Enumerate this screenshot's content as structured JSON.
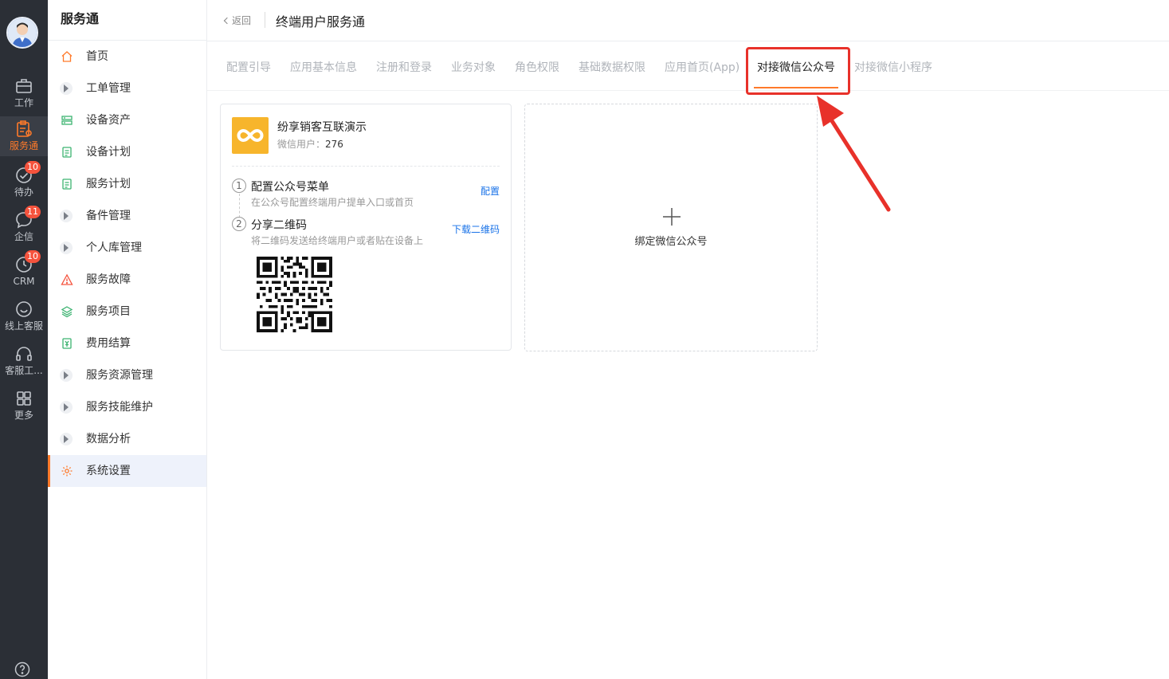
{
  "rail": {
    "items": [
      {
        "label": "工作",
        "icon": "briefcase-icon"
      },
      {
        "label": "服务通",
        "icon": "service-clipboard-icon"
      },
      {
        "label": "待办",
        "icon": "check-circle-icon",
        "badge": "10"
      },
      {
        "label": "企信",
        "icon": "chat-bubble-icon",
        "badge": "11"
      },
      {
        "label": "CRM",
        "icon": "clock-icon",
        "badge": "10"
      },
      {
        "label": "线上客服",
        "icon": "smile-chat-icon"
      },
      {
        "label": "客服工...",
        "icon": "headset-icon"
      },
      {
        "label": "更多",
        "icon": "grid-icon"
      }
    ],
    "active_index": 1,
    "help_icon": "question-circle-icon"
  },
  "sidebar": {
    "title": "服务通",
    "items": [
      {
        "label": "首页",
        "icon": "home-icon"
      },
      {
        "label": "工单管理",
        "icon": "caret-right-icon"
      },
      {
        "label": "设备资产",
        "icon": "device-asset-icon"
      },
      {
        "label": "设备计划",
        "icon": "plan-doc-icon"
      },
      {
        "label": "服务计划",
        "icon": "plan-doc-icon"
      },
      {
        "label": "备件管理",
        "icon": "caret-right-icon"
      },
      {
        "label": "个人库管理",
        "icon": "caret-right-icon"
      },
      {
        "label": "服务故障",
        "icon": "warning-icon"
      },
      {
        "label": "服务项目",
        "icon": "layers-icon"
      },
      {
        "label": "费用结算",
        "icon": "yuan-doc-icon"
      },
      {
        "label": "服务资源管理",
        "icon": "caret-right-icon"
      },
      {
        "label": "服务技能维护",
        "icon": "caret-right-icon"
      },
      {
        "label": "数据分析",
        "icon": "caret-right-icon"
      },
      {
        "label": "系统设置",
        "icon": "gear-icon"
      }
    ],
    "active_index": 13
  },
  "header": {
    "back_label": "返回",
    "title": "终端用户服务通"
  },
  "tabs": [
    {
      "label": "配置引导"
    },
    {
      "label": "应用基本信息"
    },
    {
      "label": "注册和登录"
    },
    {
      "label": "业务对象"
    },
    {
      "label": "角色权限"
    },
    {
      "label": "基础数据权限"
    },
    {
      "label": "应用首页(App)"
    },
    {
      "label": "对接微信公众号"
    },
    {
      "label": "对接微信小程序"
    }
  ],
  "active_tab_index": 7,
  "account_card": {
    "name": "纷享销客互联演示",
    "users_label": "微信用户：",
    "users_count": "276",
    "steps": [
      {
        "num": "1",
        "title": "配置公众号菜单",
        "desc": "在公众号配置终端用户提单入口或首页",
        "action": "配置"
      },
      {
        "num": "2",
        "title": "分享二维码",
        "desc": "将二维码发送给终端用户或者贴在设备上",
        "action": "下载二维码"
      }
    ]
  },
  "bind_card": {
    "label": "绑定微信公众号"
  },
  "colors": {
    "accent": "#ff7a2a",
    "link": "#1a73e8",
    "annotation": "#e8312a",
    "logo_bg": "#f7b52c",
    "rail_bg": "#2b2f36"
  }
}
